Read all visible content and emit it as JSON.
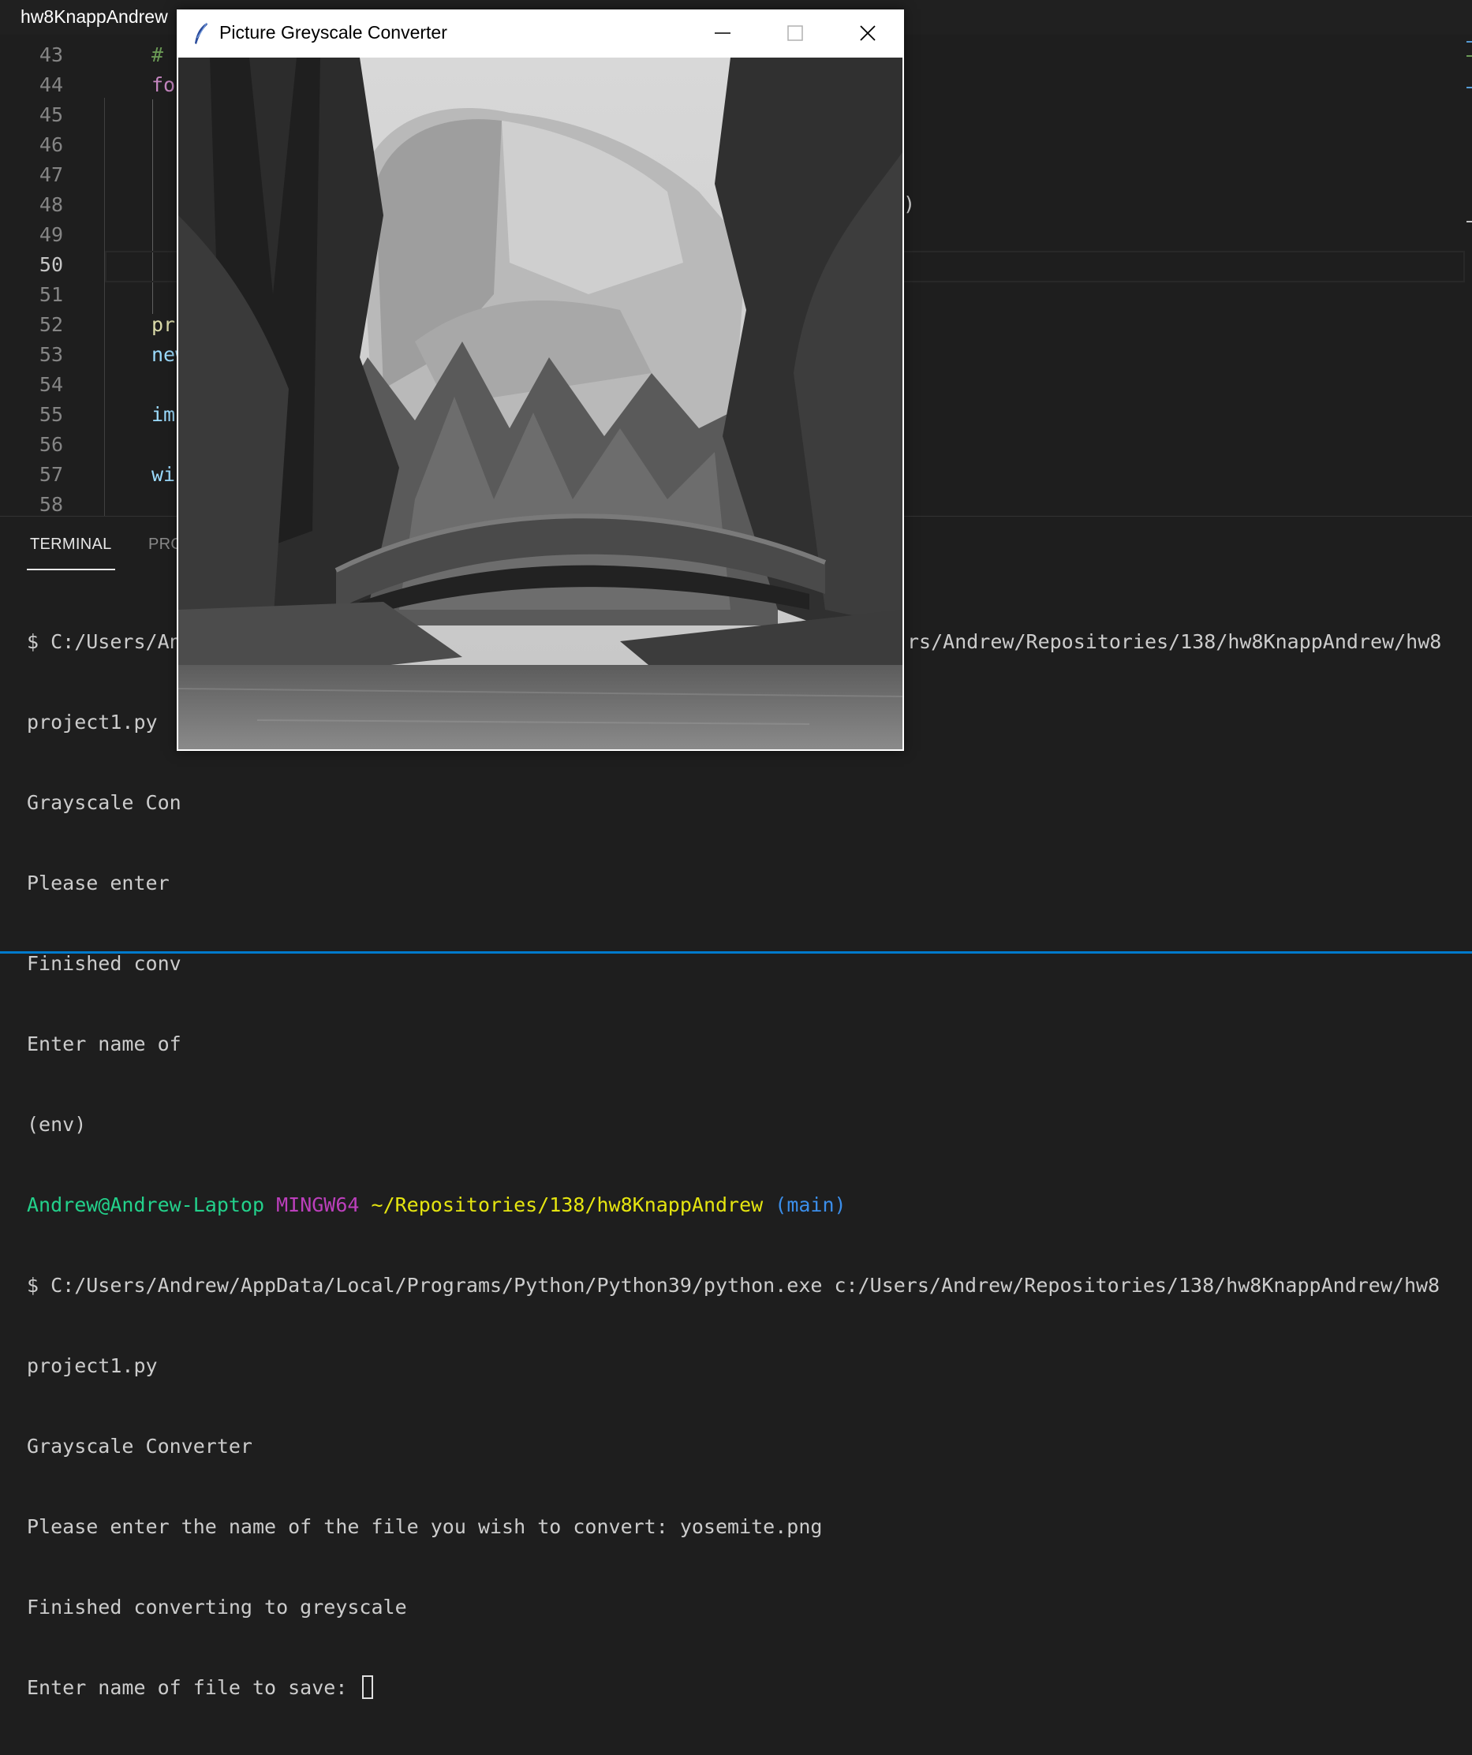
{
  "window_title": "hw8KnappAndrew",
  "editor": {
    "line_numbers": [
      "43",
      "44",
      "45",
      "46",
      "47",
      "48",
      "49",
      "50",
      "51",
      "52",
      "53",
      "54",
      "55",
      "56",
      "57",
      "58"
    ],
    "active_line": "50",
    "visible_code": [
      {
        "line": "43",
        "text": "#",
        "color": "#6a9955"
      },
      {
        "line": "44",
        "text": "fo",
        "color": "#c586c0"
      },
      {
        "line": "52",
        "text": "pr",
        "color": "#dcdcaa"
      },
      {
        "line": "53",
        "text": "new",
        "color": "#9cdcfe"
      },
      {
        "line": "55",
        "text": "im",
        "color": "#9cdcfe"
      },
      {
        "line": "57",
        "text": "wi",
        "color": "#9cdcfe"
      }
    ],
    "stray_char": ")"
  },
  "panel": {
    "tabs": [
      {
        "label": "TERMINAL",
        "active": true
      },
      {
        "label": "PRO",
        "active": false
      }
    ]
  },
  "terminal": {
    "top_partial": {
      "line1_left": "$ C:/Users/An",
      "line1_right": "rs/Andrew/Repositories/138/hw8KnappAndrew/hw8",
      "line2": "project1.py",
      "line3": "Grayscale Con",
      "line4": "Please enter",
      "line5": "Finished conv",
      "line6": "Enter name of",
      "line7": "(env)"
    },
    "prompt": {
      "user": "Andrew@Andrew-Laptop",
      "shell": "MINGW64",
      "path": "~/Repositories/138/hw8KnappAndrew",
      "branch": "(main)"
    },
    "lines": [
      "$ C:/Users/Andrew/AppData/Local/Programs/Python/Python39/python.exe c:/Users/Andrew/Repositories/138/hw8KnappAndrew/hw8",
      "project1.py",
      "Grayscale Converter",
      "Please enter the name of the file you wish to convert: yosemite.png",
      "Finished converting to greyscale"
    ],
    "last_prompt": "Enter name of file to save: "
  },
  "tk_window": {
    "title": "Picture Greyscale Converter",
    "icon": "feather-icon",
    "image_alt": "greyscale-landscape-image"
  },
  "colors": {
    "prompt_user": "#23d18b",
    "prompt_shell": "#bc3fbc",
    "prompt_path": "#e5e510",
    "prompt_branch": "#3b8eea"
  }
}
